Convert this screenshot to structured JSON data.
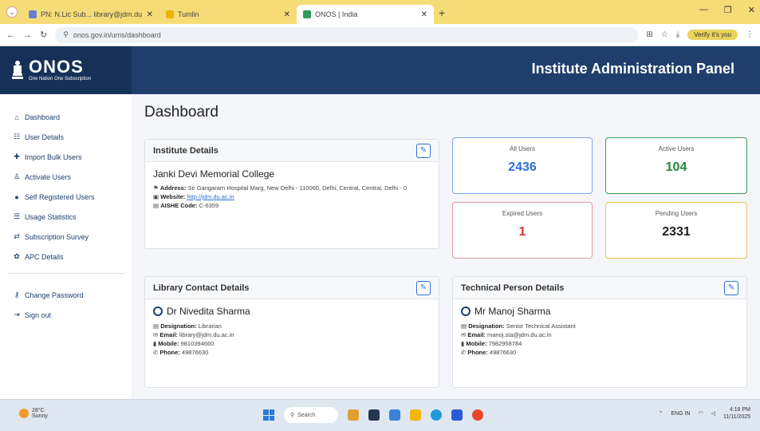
{
  "browser": {
    "tabs": [
      {
        "title": "PN: N.Lic Sub... library@jdm.du.ac..."
      },
      {
        "title": "Tumlin"
      },
      {
        "title": "ONOS | India"
      }
    ],
    "url": "onos.gov.in/ums/dashboard",
    "profile_label": "Verify it's you"
  },
  "header": {
    "logo_title": "ONOS",
    "logo_subtitle": "One Nation One Subscription",
    "panel_title": "Institute Administration Panel"
  },
  "sidebar": {
    "items": [
      {
        "label": "Dashboard",
        "icon": "home-icon"
      },
      {
        "label": "User Details",
        "icon": "users-icon"
      },
      {
        "label": "Import Bulk Users",
        "icon": "user-plus-icon"
      },
      {
        "label": "Activate Users",
        "icon": "user-check-icon"
      },
      {
        "label": "Self Registered Users",
        "icon": "info-icon"
      },
      {
        "label": "Usage Statistics",
        "icon": "list-icon"
      },
      {
        "label": "Subscription Survey",
        "icon": "exchange-icon"
      },
      {
        "label": "APC Details",
        "icon": "badge-icon"
      }
    ],
    "bottom_items": [
      {
        "label": "Change Password",
        "icon": "key-icon"
      },
      {
        "label": "Sign out",
        "icon": "sign-out-icon"
      }
    ]
  },
  "main": {
    "page_title": "Dashboard",
    "institute": {
      "card_title": "Institute Details",
      "name": "Janki Devi Memorial College",
      "address_label": "Address:",
      "address": "Sir Gangaram Hospital Marg, New Delhi - 110060, Delhi, Central, Central, Delhi - 0",
      "website_label": "Website:",
      "website": "http://jdm.du.ac.in",
      "aishe_label": "AISHE Code:",
      "aishe": "C-6359"
    },
    "stats": [
      {
        "label": "All Users",
        "value": "2436",
        "color": "#2d6fd6",
        "border": "#7aa6e8"
      },
      {
        "label": "Active Users",
        "value": "104",
        "color": "#1e8a3c",
        "border": "#3a9d5a"
      },
      {
        "label": "Expired Users",
        "value": "1",
        "color": "#d63031",
        "border": "#e59aa0"
      },
      {
        "label": "Pending Users",
        "value": "2331",
        "color": "#222222",
        "border": "#e6c750"
      }
    ],
    "library": {
      "card_title": "Library Contact Details",
      "name": "Dr Nivedita Sharma",
      "designation_label": "Designation:",
      "designation": "Librarian",
      "email_label": "Email:",
      "email": "library@jdm.du.ac.in",
      "mobile_label": "Mobile:",
      "mobile": "9810394660",
      "phone_label": "Phone:",
      "phone": "49876630"
    },
    "technical": {
      "card_title": "Technical Person Details",
      "name": "Mr Manoj Sharma",
      "designation_label": "Designation:",
      "designation": "Senior Technical Assistant",
      "email_label": "Email:",
      "email": "manoj.sta@jdm.du.ac.in",
      "mobile_label": "Mobile:",
      "mobile": "7982958784",
      "phone_label": "Phone:",
      "phone": "49876630"
    }
  },
  "taskbar": {
    "weather_temp": "28°C",
    "weather_desc": "Sunny",
    "search_placeholder": "Search",
    "lang": "ENG IN",
    "time": "4:18 PM",
    "date": "11/11/2025"
  },
  "colors": {
    "navy": "#1f3e6c",
    "accent_blue": "#2d6fd6"
  }
}
